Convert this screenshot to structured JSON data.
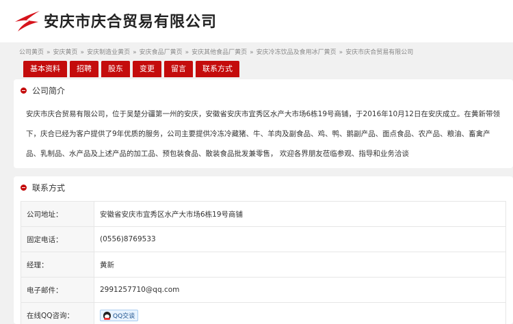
{
  "header": {
    "company_title": "安庆市庆合贸易有限公司",
    "logo_icon": "swoosh-logo-icon",
    "brand_color": "#c40c0c"
  },
  "breadcrumb": [
    "公司黄页",
    "安庆黄页",
    "安庆制造业黄页",
    "安庆食品厂黄页",
    "安庆其他食品厂黄页",
    "安庆冷冻饮品及食用冰厂黄页",
    "安庆市庆合贸易有限公司"
  ],
  "breadcrumb_sep": "»",
  "tabs": [
    "基本资料",
    "招聘",
    "股东",
    "变更",
    "留言",
    "联系方式"
  ],
  "intro": {
    "title": "公司简介",
    "text": "安庆市庆合贸易有限公司，位于吴楚分疆第一州的安庆，安徽省安庆市宜秀区水产大市场6栋19号商铺，于2016年10月12日在安庆成立。在黄新带领下，庆合已经为客户提供了9年优质的服务，公司主要提供冷冻冷藏猪、牛、羊肉及副食品、鸡、鸭、鹅副产品、面点食品、农产品、粮油、畜禽产品、乳制品、水产品及上述产品的加工品、预包装食品、散装食品批发兼零售， 欢迎各界朋友莅临参观、指导和业务洽谈"
  },
  "contact": {
    "title": "联系方式",
    "rows": [
      {
        "label": "公司地址：",
        "value": "安徽省安庆市宜秀区水产大市场6栋19号商铺"
      },
      {
        "label": "固定电话：",
        "value": "(0556)8769533"
      },
      {
        "label": "经理：",
        "value": "黄新"
      },
      {
        "label": "电子邮件：",
        "value": "2991257710@qq.com"
      }
    ],
    "qq_label": "在线QQ咨询：",
    "qq_button": "QQ交谈",
    "qq_icon": "qq-penguin-icon"
  }
}
